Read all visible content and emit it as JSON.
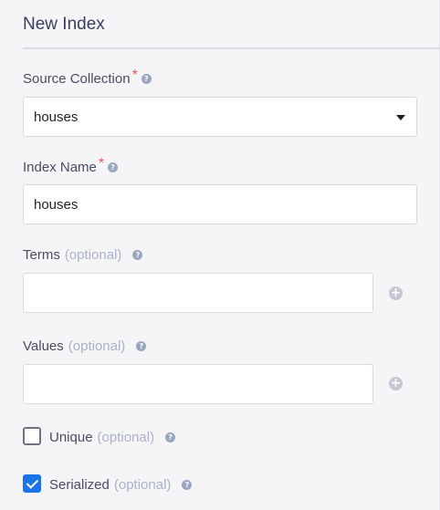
{
  "header": {
    "title": "New Index"
  },
  "source_collection": {
    "label": "Source Collection",
    "required_mark": "*",
    "value": "houses",
    "help_icon": "?"
  },
  "index_name": {
    "label": "Index Name",
    "required_mark": "*",
    "value": "houses",
    "help_icon": "?"
  },
  "terms": {
    "label": "Terms",
    "optional": "(optional)",
    "value": "",
    "help_icon": "?",
    "add_icon": "+"
  },
  "values": {
    "label": "Values",
    "optional": "(optional)",
    "value": "",
    "help_icon": "?",
    "add_icon": "+"
  },
  "unique": {
    "label": "Unique",
    "optional": "(optional)",
    "checked": false,
    "help_icon": "?"
  },
  "serialized": {
    "label": "Serialized",
    "optional": "(optional)",
    "checked": true,
    "help_icon": "?"
  },
  "colors": {
    "accent": "#1a73e8",
    "required": "#e5575b",
    "optional_text": "#aab2c8",
    "help_icon": "#9aa6bf"
  }
}
